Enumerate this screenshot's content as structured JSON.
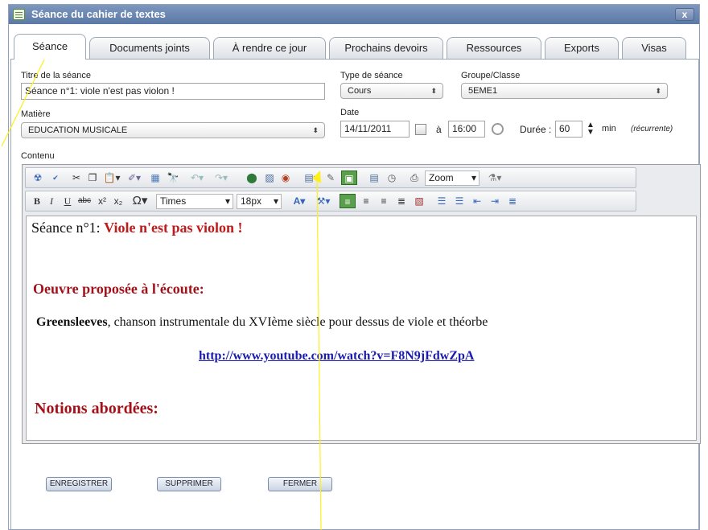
{
  "window": {
    "title": "Séance du cahier de textes",
    "close_label": "x"
  },
  "tabs": [
    "Séance",
    "Documents joints",
    "À rendre ce jour",
    "Prochains devoirs",
    "Ressources",
    "Exports",
    "Visas"
  ],
  "form": {
    "titre_label": "Titre de la séance",
    "titre_value": "Séance n°1: viole n'est pas violon !",
    "type_label": "Type de séance",
    "type_value": "Cours",
    "groupe_label": "Groupe/Classe",
    "groupe_value": "5EME1",
    "matiere_label": "Matière",
    "matiere_value": "EDUCATION MUSICALE",
    "date_label": "Date",
    "date_value": "14/11/2011",
    "time_prefix": "à",
    "time_value": "16:00",
    "duree_label": "Durée :",
    "duree_value": "60",
    "duree_unit": "min",
    "recurrente": "(récurrente)",
    "contenu_label": "Contenu"
  },
  "toolbar": {
    "font_name": "Times",
    "font_size": "18px",
    "zoom_label": "Zoom"
  },
  "content": {
    "line1_prefix": "Séance n°1: ",
    "line1_highlight": "Viole n'est pas violon !",
    "heading1": "Oeuvre proposée à l'écoute:",
    "para_bold": "Greensleeves",
    "para_rest": ", chanson instrumentale du XVIème siècle pour dessus de viole et théorbe",
    "link": "http://www.youtube.com/watch?v=F8N9jFdwZpA",
    "heading2": "Notions abordées:"
  },
  "buttons": {
    "save": "ENREGISTRER",
    "delete": "SUPPRIMER",
    "close": "FERMER"
  },
  "colors": {
    "title_bar": "#6a86b0",
    "heading_red": "#a3121a",
    "link_blue": "#1a1ab0",
    "callout_yellow": "#ffef1a"
  }
}
